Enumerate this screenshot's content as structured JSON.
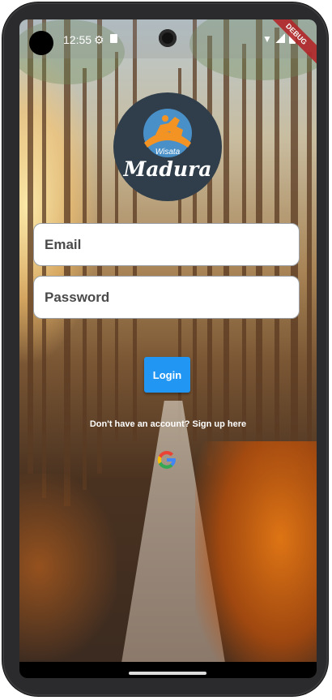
{
  "status_bar": {
    "time": "12:55"
  },
  "debug_banner": "DEBUG",
  "logo": {
    "line1": "Wisata",
    "line2": "Madura"
  },
  "email": {
    "placeholder": "Email",
    "value": ""
  },
  "password": {
    "placeholder": "Password",
    "value": ""
  },
  "login_button": {
    "label": "Login"
  },
  "signup": {
    "label": "Don't have an account? Sign up here"
  },
  "google_button": {
    "icon": "google-icon"
  },
  "colors": {
    "primary": "#2196f3",
    "logo_bg": "#2f3e4a",
    "logo_orange": "#f39323"
  }
}
